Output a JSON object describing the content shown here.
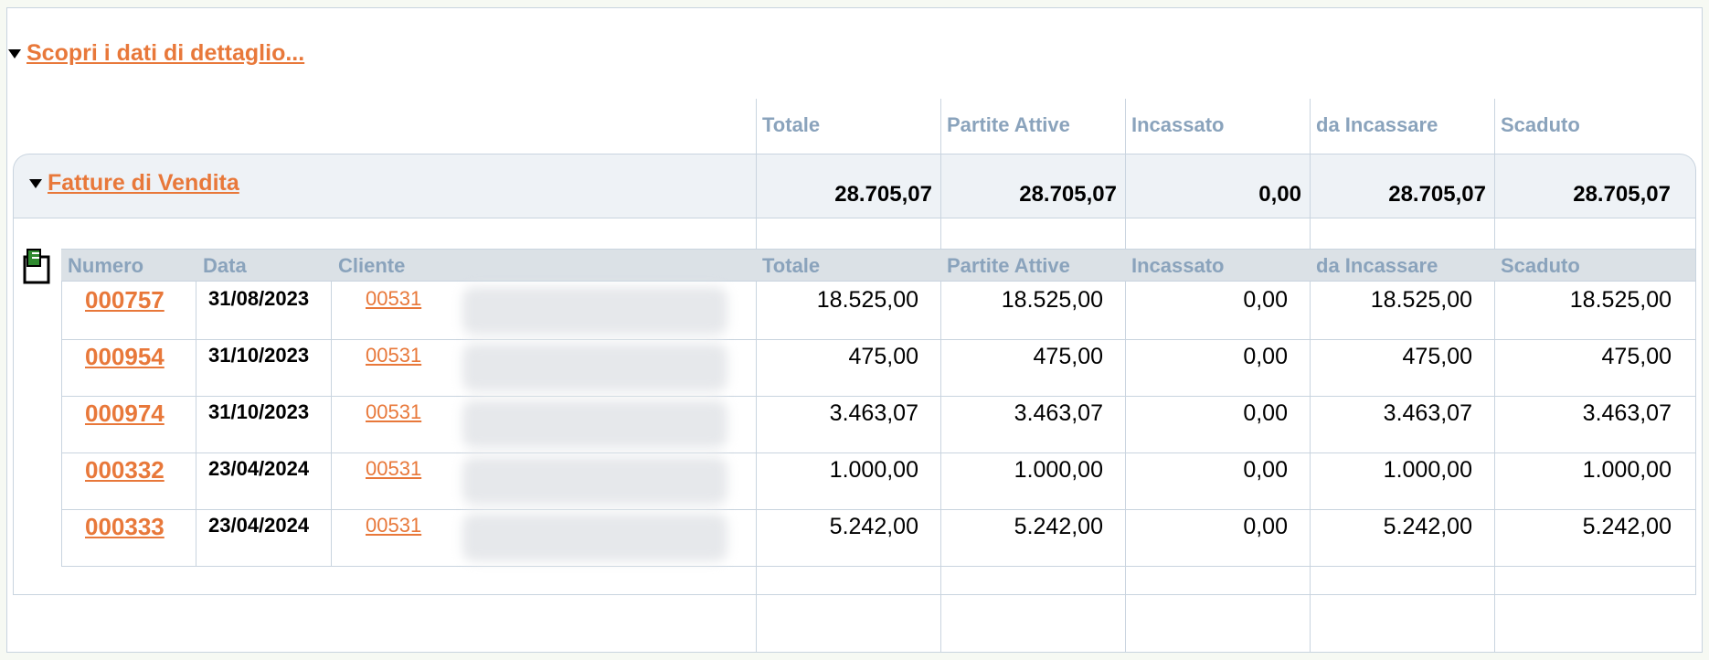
{
  "section_title": "Scopri i dati di dettaglio...",
  "group_title": "Fatture di Vendita",
  "columns": [
    "Totale",
    "Partite Attive",
    "Incassato",
    "da Incassare",
    "Scaduto"
  ],
  "group_totals": [
    "28.705,07",
    "28.705,07",
    "0,00",
    "28.705,07",
    "28.705,07"
  ],
  "grid_headers": {
    "numero": "Numero",
    "data": "Data",
    "cliente": "Cliente",
    "totale": "Totale",
    "partite": "Partite Attive",
    "incassato": "Incassato",
    "da_incassare": "da Incassare",
    "scaduto": "Scaduto"
  },
  "rows": [
    {
      "numero": "000757",
      "data": "31/08/2023",
      "cliente": "00531",
      "totale": "18.525,00",
      "partite": "18.525,00",
      "incassato": "0,00",
      "da_incassare": "18.525,00",
      "scaduto": "18.525,00"
    },
    {
      "numero": "000954",
      "data": "31/10/2023",
      "cliente": "00531",
      "totale": "475,00",
      "partite": "475,00",
      "incassato": "0,00",
      "da_incassare": "475,00",
      "scaduto": "475,00"
    },
    {
      "numero": "000974",
      "data": "31/10/2023",
      "cliente": "00531",
      "totale": "3.463,07",
      "partite": "3.463,07",
      "incassato": "0,00",
      "da_incassare": "3.463,07",
      "scaduto": "3.463,07"
    },
    {
      "numero": "000332",
      "data": "23/04/2024",
      "cliente": "00531",
      "totale": "1.000,00",
      "partite": "1.000,00",
      "incassato": "0,00",
      "da_incassare": "1.000,00",
      "scaduto": "1.000,00"
    },
    {
      "numero": "000333",
      "data": "23/04/2024",
      "cliente": "00531",
      "totale": "5.242,00",
      "partite": "5.242,00",
      "incassato": "0,00",
      "da_incassare": "5.242,00",
      "scaduto": "5.242,00"
    }
  ],
  "colors": {
    "link": "#e8783a",
    "header": "#8aa3bc",
    "border": "#c9d4df"
  },
  "icons": {
    "export": "export-icon",
    "expand": "triangle-down-icon"
  }
}
